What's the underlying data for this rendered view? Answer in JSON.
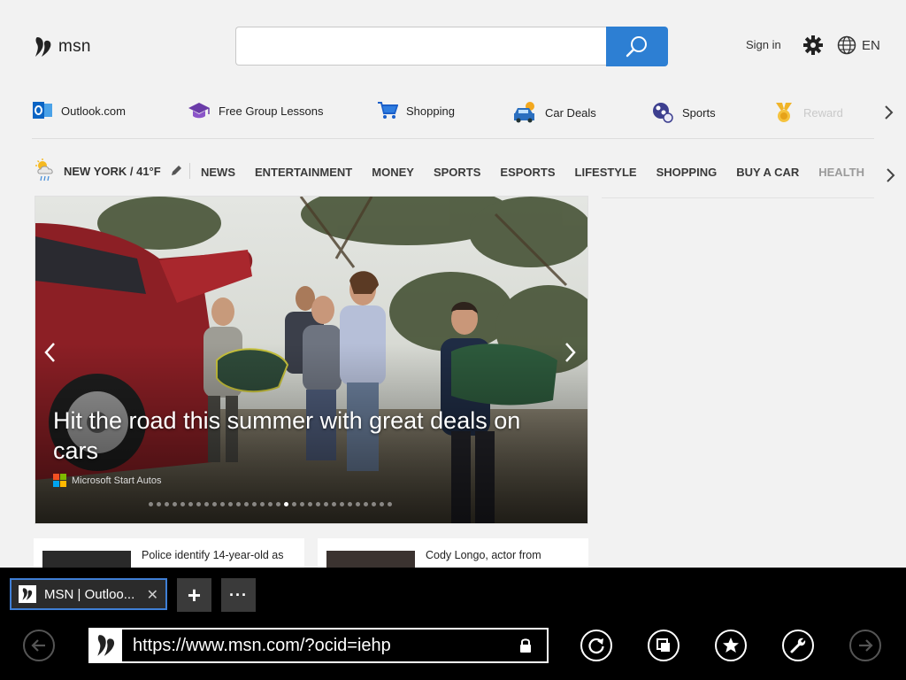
{
  "header": {
    "logo_text": "msn",
    "search_placeholder": "",
    "sign_in": "Sign in",
    "language": "EN"
  },
  "quick_links": [
    {
      "label": "Outlook.com",
      "icon": "outlook-icon"
    },
    {
      "label": "Free Group Lessons",
      "icon": "graduation-cap-icon"
    },
    {
      "label": "Shopping",
      "icon": "shopping-cart-icon"
    },
    {
      "label": "Car Deals",
      "icon": "car-icon"
    },
    {
      "label": "Sports",
      "icon": "sports-ball-icon"
    },
    {
      "label": "Rewards",
      "icon": "rewards-medal-icon"
    }
  ],
  "weather": {
    "label": "NEW YORK / 41°F"
  },
  "nav_items": [
    "NEWS",
    "ENTERTAINMENT",
    "MONEY",
    "SPORTS",
    "ESPORTS",
    "LIFESTYLE",
    "SHOPPING",
    "BUY A CAR",
    "HEALTH"
  ],
  "hero": {
    "title": "Hit the road this summer with great deals on cars",
    "source": "Microsoft Start Autos",
    "slide_count": 31,
    "active_slide": 18
  },
  "cards": [
    {
      "title": "Police identify 14-year-old as"
    },
    {
      "title": "Cody Longo, actor from"
    }
  ],
  "browser": {
    "tab_title": "MSN | Outloo...",
    "tab_close": "✕",
    "new_tab": "+",
    "more": "···",
    "url": "https://www.msn.com/?ocid=iehp"
  },
  "colors": {
    "search_button": "#2d7fd3",
    "tab_border": "#3f7fd6",
    "page_background": "#f2f2f2"
  }
}
